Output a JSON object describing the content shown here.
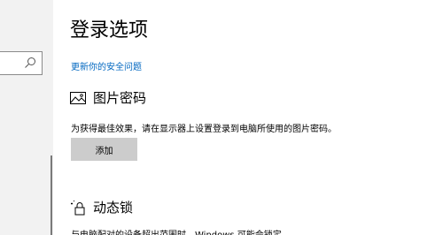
{
  "page": {
    "title": "登录选项",
    "security_question_link": "更新你的安全问题"
  },
  "picture_password": {
    "icon": "picture-icon",
    "title": "图片密码",
    "description": "为获得最佳效果，请在显示器上设置登录到电脑所使用的图片密码。",
    "add_button": "添加"
  },
  "dynamic_lock": {
    "icon": "dynamic-lock-icon",
    "title": "动态锁",
    "description": "与电脑配对的设备超出范围时，Windows 可能会锁定"
  },
  "search": {
    "icon": "search-icon"
  },
  "colors": {
    "link": "#0067c0",
    "button_bg": "#cccccc",
    "nav_bg": "#f2f2f2"
  }
}
